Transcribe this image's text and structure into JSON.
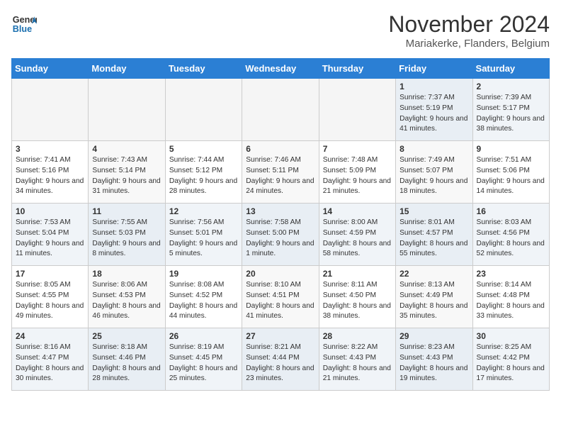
{
  "header": {
    "logo_line1": "General",
    "logo_line2": "Blue",
    "month": "November 2024",
    "location": "Mariakerke, Flanders, Belgium"
  },
  "weekdays": [
    "Sunday",
    "Monday",
    "Tuesday",
    "Wednesday",
    "Thursday",
    "Friday",
    "Saturday"
  ],
  "weeks": [
    [
      {
        "day": "",
        "info": ""
      },
      {
        "day": "",
        "info": ""
      },
      {
        "day": "",
        "info": ""
      },
      {
        "day": "",
        "info": ""
      },
      {
        "day": "",
        "info": ""
      },
      {
        "day": "1",
        "info": "Sunrise: 7:37 AM\nSunset: 5:19 PM\nDaylight: 9 hours and 41 minutes."
      },
      {
        "day": "2",
        "info": "Sunrise: 7:39 AM\nSunset: 5:17 PM\nDaylight: 9 hours and 38 minutes."
      }
    ],
    [
      {
        "day": "3",
        "info": "Sunrise: 7:41 AM\nSunset: 5:16 PM\nDaylight: 9 hours and 34 minutes."
      },
      {
        "day": "4",
        "info": "Sunrise: 7:43 AM\nSunset: 5:14 PM\nDaylight: 9 hours and 31 minutes."
      },
      {
        "day": "5",
        "info": "Sunrise: 7:44 AM\nSunset: 5:12 PM\nDaylight: 9 hours and 28 minutes."
      },
      {
        "day": "6",
        "info": "Sunrise: 7:46 AM\nSunset: 5:11 PM\nDaylight: 9 hours and 24 minutes."
      },
      {
        "day": "7",
        "info": "Sunrise: 7:48 AM\nSunset: 5:09 PM\nDaylight: 9 hours and 21 minutes."
      },
      {
        "day": "8",
        "info": "Sunrise: 7:49 AM\nSunset: 5:07 PM\nDaylight: 9 hours and 18 minutes."
      },
      {
        "day": "9",
        "info": "Sunrise: 7:51 AM\nSunset: 5:06 PM\nDaylight: 9 hours and 14 minutes."
      }
    ],
    [
      {
        "day": "10",
        "info": "Sunrise: 7:53 AM\nSunset: 5:04 PM\nDaylight: 9 hours and 11 minutes."
      },
      {
        "day": "11",
        "info": "Sunrise: 7:55 AM\nSunset: 5:03 PM\nDaylight: 9 hours and 8 minutes."
      },
      {
        "day": "12",
        "info": "Sunrise: 7:56 AM\nSunset: 5:01 PM\nDaylight: 9 hours and 5 minutes."
      },
      {
        "day": "13",
        "info": "Sunrise: 7:58 AM\nSunset: 5:00 PM\nDaylight: 9 hours and 1 minute."
      },
      {
        "day": "14",
        "info": "Sunrise: 8:00 AM\nSunset: 4:59 PM\nDaylight: 8 hours and 58 minutes."
      },
      {
        "day": "15",
        "info": "Sunrise: 8:01 AM\nSunset: 4:57 PM\nDaylight: 8 hours and 55 minutes."
      },
      {
        "day": "16",
        "info": "Sunrise: 8:03 AM\nSunset: 4:56 PM\nDaylight: 8 hours and 52 minutes."
      }
    ],
    [
      {
        "day": "17",
        "info": "Sunrise: 8:05 AM\nSunset: 4:55 PM\nDaylight: 8 hours and 49 minutes."
      },
      {
        "day": "18",
        "info": "Sunrise: 8:06 AM\nSunset: 4:53 PM\nDaylight: 8 hours and 46 minutes."
      },
      {
        "day": "19",
        "info": "Sunrise: 8:08 AM\nSunset: 4:52 PM\nDaylight: 8 hours and 44 minutes."
      },
      {
        "day": "20",
        "info": "Sunrise: 8:10 AM\nSunset: 4:51 PM\nDaylight: 8 hours and 41 minutes."
      },
      {
        "day": "21",
        "info": "Sunrise: 8:11 AM\nSunset: 4:50 PM\nDaylight: 8 hours and 38 minutes."
      },
      {
        "day": "22",
        "info": "Sunrise: 8:13 AM\nSunset: 4:49 PM\nDaylight: 8 hours and 35 minutes."
      },
      {
        "day": "23",
        "info": "Sunrise: 8:14 AM\nSunset: 4:48 PM\nDaylight: 8 hours and 33 minutes."
      }
    ],
    [
      {
        "day": "24",
        "info": "Sunrise: 8:16 AM\nSunset: 4:47 PM\nDaylight: 8 hours and 30 minutes."
      },
      {
        "day": "25",
        "info": "Sunrise: 8:18 AM\nSunset: 4:46 PM\nDaylight: 8 hours and 28 minutes."
      },
      {
        "day": "26",
        "info": "Sunrise: 8:19 AM\nSunset: 4:45 PM\nDaylight: 8 hours and 25 minutes."
      },
      {
        "day": "27",
        "info": "Sunrise: 8:21 AM\nSunset: 4:44 PM\nDaylight: 8 hours and 23 minutes."
      },
      {
        "day": "28",
        "info": "Sunrise: 8:22 AM\nSunset: 4:43 PM\nDaylight: 8 hours and 21 minutes."
      },
      {
        "day": "29",
        "info": "Sunrise: 8:23 AM\nSunset: 4:43 PM\nDaylight: 8 hours and 19 minutes."
      },
      {
        "day": "30",
        "info": "Sunrise: 8:25 AM\nSunset: 4:42 PM\nDaylight: 8 hours and 17 minutes."
      }
    ]
  ]
}
